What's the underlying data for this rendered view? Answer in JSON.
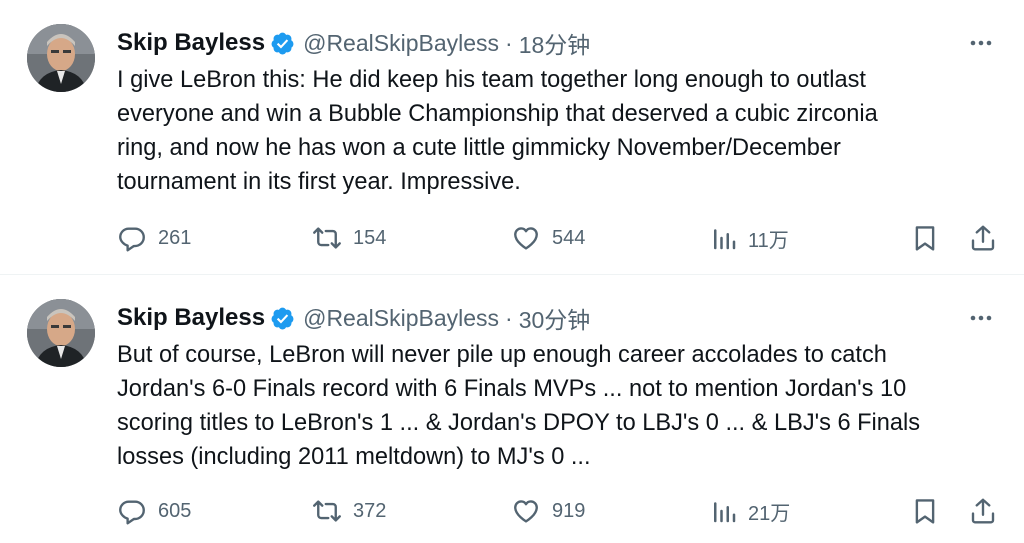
{
  "tweets": [
    {
      "author": {
        "name": "Skip Bayless",
        "handle": "@RealSkipBayless",
        "verified_icon": "verified-badge-icon"
      },
      "separator": "·",
      "time": "18分钟",
      "text_lines": [
        "I give LeBron this: He did keep his team together long enough to outlast",
        "everyone and win a Bubble Championship that deserved a cubic zirconia",
        "ring, and now he has won a cute little gimmicky November/December",
        "tournament in its first year. Impressive."
      ],
      "stats": {
        "replies": "261",
        "retweets": "154",
        "likes": "544",
        "views": "11万"
      }
    },
    {
      "author": {
        "name": "Skip Bayless",
        "handle": "@RealSkipBayless",
        "verified_icon": "verified-badge-icon"
      },
      "separator": "·",
      "time": "30分钟",
      "text_lines": [
        "But of course, LeBron will never pile up enough career accolades to catch",
        "Jordan's 6-0 Finals record with 6 Finals MVPs ... not to mention Jordan's 10",
        "scoring titles to LeBron's 1 ... & Jordan's DPOY to LBJ's 0 ... & LBJ's 6 Finals",
        "losses (including 2011 meltdown) to MJ's 0 ..."
      ],
      "stats": {
        "replies": "605",
        "retweets": "372",
        "likes": "919",
        "views": "21万"
      }
    }
  ],
  "colors": {
    "text_primary": "#0f1419",
    "text_secondary": "#536471",
    "verified_blue": "#1d9bf0",
    "divider": "#eff3f4"
  }
}
